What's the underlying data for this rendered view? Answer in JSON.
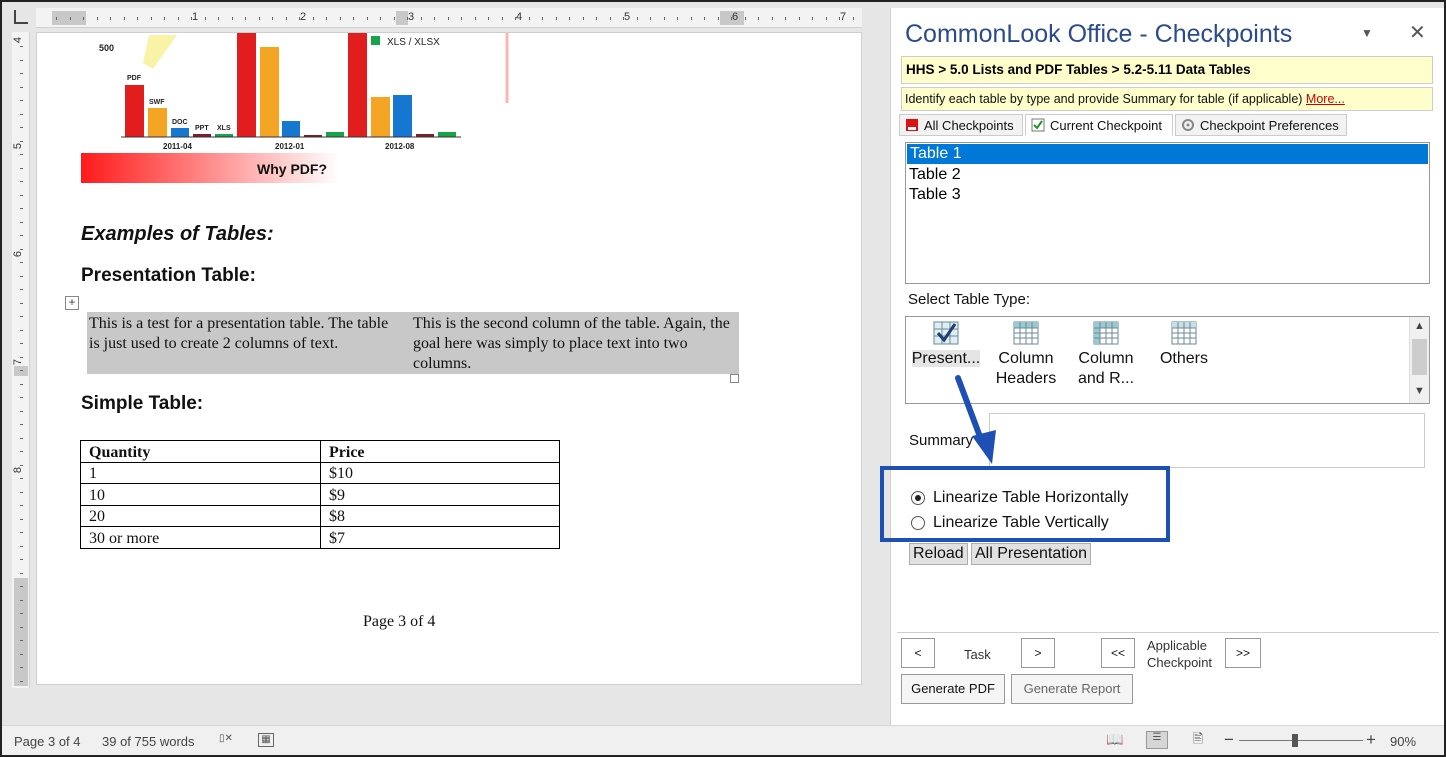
{
  "ruler": {
    "h_numbers": [
      "1",
      "2",
      "3",
      "4",
      "5",
      "6",
      "7"
    ],
    "v_numbers": [
      "4",
      "5",
      "6",
      "7",
      "8"
    ]
  },
  "document": {
    "chart": {
      "label_500": "500",
      "legend_xls": "XLS / XLSX",
      "bar_labels": [
        "PDF",
        "SWF",
        "DOC",
        "PPT",
        "XLS"
      ],
      "group_labels": [
        "2011-04",
        "2012-01",
        "2012-08"
      ],
      "caption": "Why PDF?"
    },
    "heading_examples": "Examples of Tables:",
    "heading_presentation": "Presentation Table:",
    "presentation_table": {
      "col1": "This is a test for a presentation table. The table is just used to create 2 columns of text.",
      "col2": "This is the second column of the table. Again, the goal here was simply to place text into two columns."
    },
    "heading_simple": "Simple Table:",
    "simple_table": {
      "headers": [
        "Quantity",
        "Price"
      ],
      "rows": [
        [
          "1",
          "$10"
        ],
        [
          "10",
          "$9"
        ],
        [
          "20",
          "$8"
        ],
        [
          "30 or more",
          "$7"
        ]
      ]
    },
    "page_number": "Page 3 of 4"
  },
  "statusbar": {
    "page": "Page 3 of 4",
    "words": "39 of 755 words",
    "zoom": "90%"
  },
  "pane": {
    "title": "CommonLook Office - Checkpoints",
    "breadcrumb": "HHS > 5.0 Lists and PDF Tables > 5.2-5.11 Data Tables",
    "description": "Identify each table by type and provide Summary for table (if applicable)",
    "more_link": "More...",
    "tabs": [
      "All Checkpoints",
      "Current Checkpoint",
      "Checkpoint Preferences"
    ],
    "tables": [
      "Table 1",
      "Table 2",
      "Table 3"
    ],
    "select_type_label": "Select Table Type:",
    "types": [
      {
        "line1": "Present...",
        "line2": ""
      },
      {
        "line1": "Column",
        "line2": "Headers"
      },
      {
        "line1": "Column",
        "line2": "and R..."
      },
      {
        "line1": "Others",
        "line2": ""
      }
    ],
    "summary_label": "Summary",
    "radios": [
      "Linearize Table Horizontally",
      "Linearize Table Vertically"
    ],
    "selected_radio": 0,
    "buttons": {
      "reload": "Reload",
      "all_presentation": "All Presentation"
    },
    "nav": {
      "prev": "<",
      "task": "Task",
      "next": ">",
      "prev_app": "<<",
      "applicable_line1": "Applicable",
      "applicable_line2": "Checkpoint",
      "next_app": ">>"
    },
    "generate_pdf": "Generate PDF",
    "generate_report": "Generate Report"
  },
  "colors": {
    "pane_title": "#2b4b8c",
    "selection": "#0078d7",
    "highlight_box": "#1e4fb5",
    "more_link": "#cc0000",
    "breadcrumb_bg": "#ffffcc"
  }
}
